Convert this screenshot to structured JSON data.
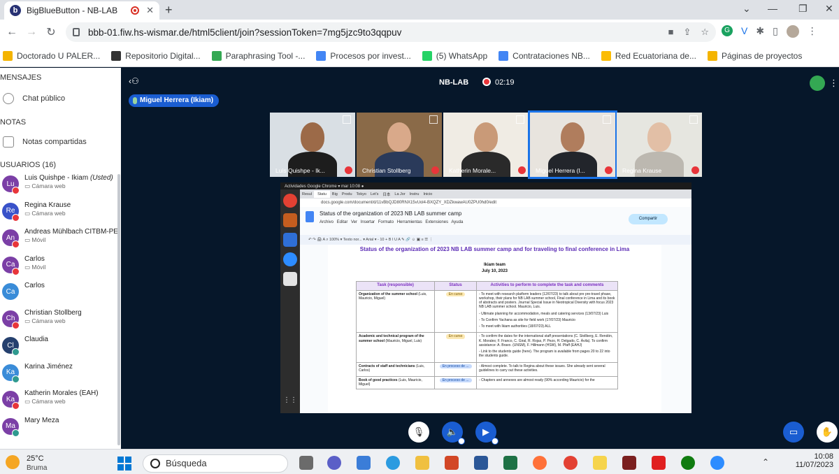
{
  "browser": {
    "tab_title": "BigBlueButton - NB-LAB",
    "tab_favicon": "b",
    "url": "bbb-01.fiw.hs-wismar.de/html5client/join?sessionToken=7mg5jzc9to3qqpuv",
    "bookmarks": [
      {
        "label": "Doctorado U PALER...",
        "color": "#f4b400"
      },
      {
        "label": "Repositorio Digital...",
        "color": "#333333"
      },
      {
        "label": "Paraphrasing Tool -...",
        "color": "#34a853"
      },
      {
        "label": "Procesos por invest...",
        "color": "#4285f4"
      },
      {
        "label": "(5) WhatsApp",
        "color": "#25d366"
      },
      {
        "label": "Contrataciones NB...",
        "color": "#4285f4"
      },
      {
        "label": "Red Ecuatoriana de...",
        "color": "#fbbc04"
      },
      {
        "label": "Páginas de proyectos",
        "color": "#f4b400"
      }
    ]
  },
  "sidebar": {
    "messages_header": "MENSAJES",
    "public_chat": "Chat público",
    "notes_header": "NOTAS",
    "shared_notes": "Notas compartidas",
    "users_header": "USUARIOS (16)",
    "users": [
      {
        "initials": "Lu",
        "name": "Luis Quishpe - Ikiam",
        "suffix": "(Usted)",
        "sub": "Cámara web",
        "color": "#7b3fa6",
        "status": "#e8353a"
      },
      {
        "initials": "Re",
        "name": "Regina Krause",
        "suffix": "",
        "sub": "Cámara web",
        "color": "#3952c9",
        "status": "#e8353a"
      },
      {
        "initials": "An",
        "name": "Andreas Mühlbach CITBM-PE",
        "suffix": "",
        "sub": "Móvil",
        "color": "#7b3fa6",
        "status": "#e8353a"
      },
      {
        "initials": "Ca",
        "name": "Carlos",
        "suffix": "",
        "sub": "Móvil",
        "color": "#7b3fa6",
        "status": "#e8353a"
      },
      {
        "initials": "Ca",
        "name": "Carlos",
        "suffix": "",
        "sub": "",
        "color": "#3a8cd8",
        "status": ""
      },
      {
        "initials": "Ch",
        "name": "Christian Stollberg",
        "suffix": "",
        "sub": "Cámara web",
        "color": "#7b3fa6",
        "status": "#e8353a"
      },
      {
        "initials": "Cl",
        "name": "Claudia",
        "suffix": "",
        "sub": "",
        "color": "#25406e",
        "status": "#2f9a8f"
      },
      {
        "initials": "Ka",
        "name": "Karina Jiménez",
        "suffix": "",
        "sub": "",
        "color": "#3a8cd8",
        "status": "#2f9a8f"
      },
      {
        "initials": "Ka",
        "name": "Katherin Morales (EAH)",
        "suffix": "",
        "sub": "Cámara web",
        "color": "#7b3fa6",
        "status": "#e8353a"
      },
      {
        "initials": "Ma",
        "name": "Mary Meza",
        "suffix": "",
        "sub": "",
        "color": "#7b3fa6",
        "status": "#2f9a8f"
      }
    ]
  },
  "meeting": {
    "title": "NB-LAB",
    "timer": "02:19",
    "speaker": "Miguel Herrera (Ikiam)",
    "videos": [
      {
        "name": "Luis Quishpe - Ik...",
        "bg": "#d9dfe4",
        "skin": "#9c6a48",
        "shirt": "#1d1d1d",
        "active": false
      },
      {
        "name": "Christian Stollberg",
        "bg": "#8a6a48",
        "skin": "#d9a98a",
        "shirt": "#2a3a5a",
        "active": false
      },
      {
        "name": "Katherin Morale...",
        "bg": "#f0ece4",
        "skin": "#c99a78",
        "shirt": "#2a2a2a",
        "active": false
      },
      {
        "name": "Miguel Herrera (I...",
        "bg": "#e8e4de",
        "skin": "#b07d5d",
        "shirt": "#22252b",
        "active": true
      },
      {
        "name": "Regina Krause",
        "bg": "#e6e6e0",
        "skin": "#e2bfa6",
        "shirt": "#bcb8b0",
        "active": false
      }
    ]
  },
  "share": {
    "os_bar": "Actividades   Google Chrome ▾              mar 10:08 ●",
    "tabs": [
      "Resul",
      "Statu",
      "Big",
      "Produ",
      "Tokyo",
      "Let's",
      "日本",
      "La Jor",
      "Instru",
      "Inicio"
    ],
    "address": "docs.google.com/document/d/11vBbQJD80RNX15vUol4-BXQZY_XDZkwawAU0ZPU0hd0/edit",
    "doc_title": "Status of the organization of 2023 NB LAB summer camp",
    "menu": "Archivo Editar Ver Insertar Formato Herramientas Extensiones Ayuda",
    "share_button": "Compartir",
    "format_bar": "↶  ↷  🖨  A  ⌕   100%  ▾   Texto nor...  ▾   Arial  ▾   -  10  +   B  I  U  A  ✎   🔗  ☺  ▣   ≡  ☰  ⋮",
    "heading1": "Status of the organization of 2023 NB LAB summer camp and for traveling to final conference in Lima",
    "heading2": "Ikiam team",
    "heading3": "July 10, 2023",
    "col_task": "Task (responsible)",
    "col_status": "Status",
    "col_activities": "Activities to perform to complete the task and comments",
    "rows": [
      {
        "task": "Organization of the summer school",
        "resp": "(Luis, Mauricio, Miguel)",
        "status": "En curso",
        "blue": false,
        "acts": [
          "- To meet with research platform leaders (12/07/23) to talk about pre pre-travel phase, workshop, their plans for NB LAB summer school, Final conference in Lima and its book of abstracts and posters. Journal Special Issue in Neotropical Diversity with focus 2023 NB LAB summer school. Mauricio, Luis.",
          "- Ultimate planning for accommodation, meals and catering services (13/07/23) Luis",
          "- To Confirm Yachana as site for field work (17/07/23) Mauricio",
          "- To meet with Ikiam authorities (18/07/23) ALL"
        ]
      },
      {
        "task": "Academic and technical program of the summer school",
        "resp": "(Mauricio, Miguel, Luis)",
        "status": "En curso",
        "blue": false,
        "acts": [
          "- To confirm the dates for the international staff presentations (C. Stollberg, E. Rendón, K. Morales; F. Franco, C. Giral, R. Rojas, P. Pezo, H. Delgado, C. Ávila). To confirm assistance: A. Bravo. (UNSM), F. Hillmann (HSW), M. Pfaff (EAHJ)",
          "- Link to the students guide (here). The program is available from pages 20 to 22 into the students guide."
        ]
      },
      {
        "task": "Contracts of staff and technicians",
        "resp": "(Luis, Carlos)",
        "status": "En proceso de ...",
        "blue": true,
        "acts": [
          "- Almost complete. To talk to Regina about these issues. She already sent several guidelines to carry out these activities."
        ]
      },
      {
        "task": "Book of good practices",
        "resp": "(Luis, Mauricio, Miguel)",
        "status": "En proceso de ...",
        "blue": true,
        "acts": [
          "- Chapters and annexes are almost ready (90% according Mauricio) for the"
        ]
      }
    ]
  },
  "taskbar": {
    "temp": "25°C",
    "weather": "Bruma",
    "search": "Búsqueda",
    "time": "10:08",
    "date": "11/07/2023"
  }
}
